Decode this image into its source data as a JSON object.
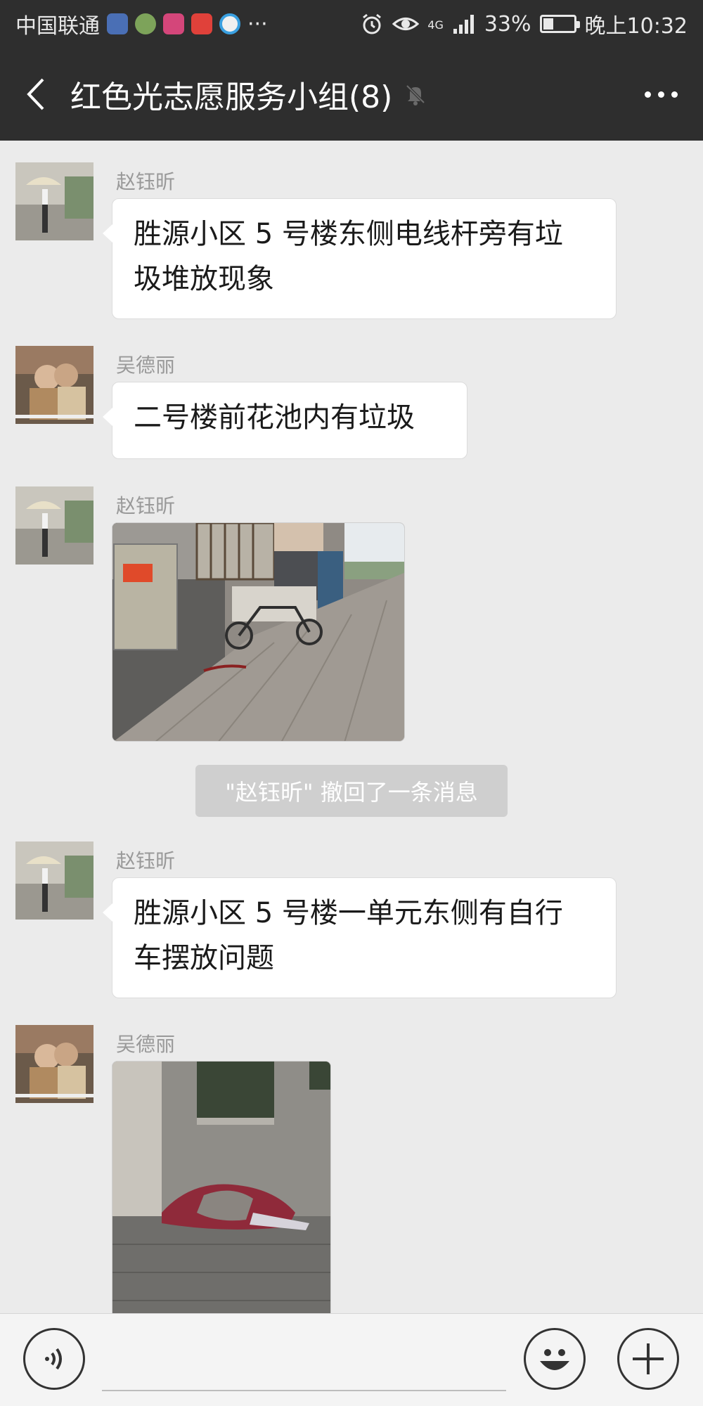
{
  "status_bar": {
    "carrier": "中国联通",
    "ellipsis": "···",
    "network": "4G",
    "battery_percent": "33%",
    "battery_level": 0.33,
    "time": "晚上10:32"
  },
  "header": {
    "title": "红色光志愿服务小组(8)"
  },
  "messages": [
    {
      "sender": "赵钰昕",
      "type": "text",
      "line1": "胜源小区 5 号楼东侧电线杆旁有垃",
      "line2": "圾堆放现象"
    },
    {
      "sender": "吴德丽",
      "type": "text",
      "line1": "二号楼前花池内有垃圾"
    },
    {
      "sender": "赵钰昕",
      "type": "image"
    },
    {
      "sender": "赵钰昕",
      "type": "text",
      "line1": "胜源小区 5 号楼一单元东侧有自行",
      "line2": "车摆放问题"
    },
    {
      "sender": "吴德丽",
      "type": "image"
    }
  ],
  "system_notice": "\"赵钰昕\" 撤回了一条消息",
  "input_bar": {
    "voice_icon": "voice-icon",
    "emoji_icon": "emoji-icon",
    "plus_icon": "plus-icon"
  },
  "colors": {
    "header_bg": "#2e2e2e",
    "chat_bg": "#ebebeb",
    "bubble_bg": "#ffffff",
    "sender_text": "#999999"
  }
}
